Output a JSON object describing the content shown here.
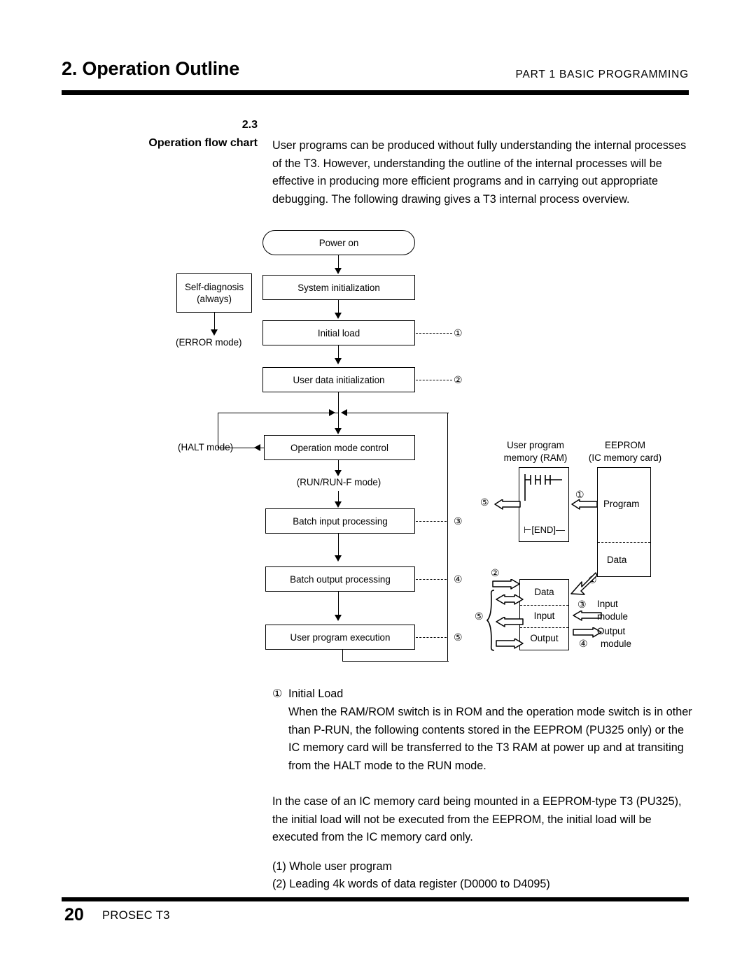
{
  "header": {
    "chapter_title": "2. Operation Outline",
    "part_label": "PART 1  BASIC  PROGRAMMING"
  },
  "section": {
    "number": "2.3",
    "name": "Operation flow chart",
    "intro": "User programs can be produced without fully understanding the internal processes of the T3.  However, understanding the outline of the internal processes will be effective in producing more efficient programs and in carrying out appropriate debugging.  The following drawing gives a T3 internal process overview."
  },
  "flowchart": {
    "power_on": "Power on",
    "self_diagnosis": "Self-diagnosis\n(always)",
    "self_diagnosis_line1": "Self-diagnosis",
    "self_diagnosis_line2": "(always)",
    "error_mode": "(ERROR mode)",
    "system_initialization": "System initialization",
    "initial_load": "Initial load",
    "user_data_initialization": "User data initialization",
    "halt_mode": "(HALT mode)",
    "operation_mode_control": "Operation mode control",
    "run_mode": "(RUN/RUN-F mode)",
    "batch_input_processing": "Batch input processing",
    "batch_output_processing": "Batch output processing",
    "user_program_execution": "User program execution",
    "callouts": {
      "one": "①",
      "two": "②",
      "three": "③",
      "four": "④",
      "five": "⑤"
    }
  },
  "memory_diagram": {
    "ram_title_line1": "User program",
    "ram_title_line2": "memory (RAM)",
    "eeprom_title_line1": "EEPROM",
    "eeprom_title_line2": "(IC memory card)",
    "ram_end_symbol": "⊢[END]—",
    "eeprom_program": "Program",
    "eeprom_data": "Data",
    "ram_data": "Data",
    "ram_input": "Input",
    "ram_output": "Output",
    "input_module_line1": "Input",
    "input_module_line2": "module",
    "output_module_line1": "Output",
    "output_module_line2": "module",
    "marks": {
      "one": "①",
      "two": "②",
      "three": "③",
      "four": "④",
      "five": "⑤"
    }
  },
  "notes": {
    "item1_marker": "①",
    "item1_title": "Initial Load",
    "item1_body": "When the RAM/ROM switch is in ROM and the operation mode switch is in other than P-RUN, the following contents stored in the EEPROM (PU325 only) or the IC memory card will be transferred to the T3 RAM at power up and at transiting from the HALT mode to the RUN mode.",
    "item2_body": "In the case of an IC memory card being mounted in a EEPROM-type T3 (PU325), the initial load will not be executed from the EEPROM, the initial load will be executed from the IC memory card only.",
    "list1": "(1) Whole user program",
    "list2": "(2) Leading 4k words of data register (D0000 to D4095)"
  },
  "footer": {
    "page_number": "20",
    "product": "PROSEC T3"
  }
}
